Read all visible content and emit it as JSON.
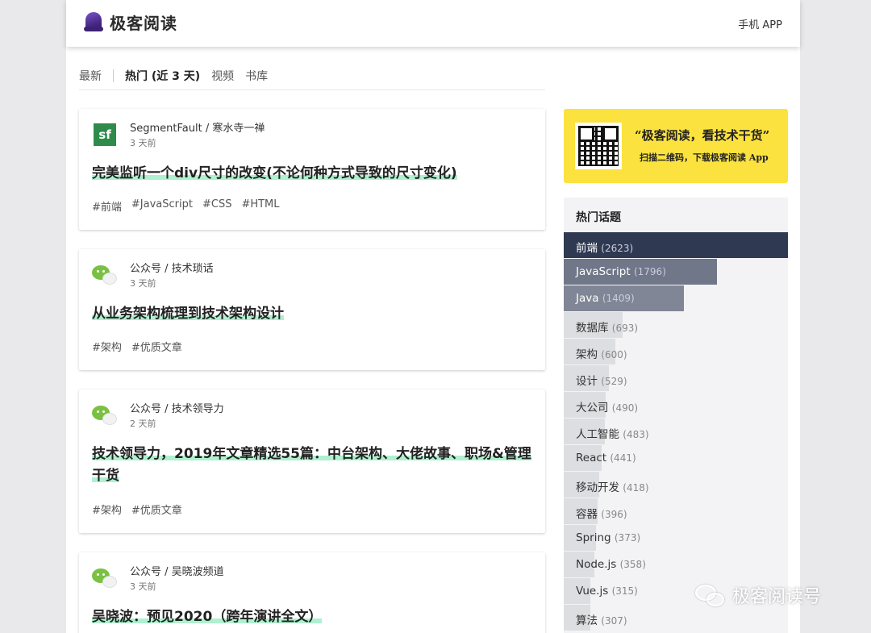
{
  "header": {
    "brand": "极客阅读",
    "mobile_app": "手机 APP"
  },
  "tabs": [
    {
      "label": "最新",
      "active": false
    },
    {
      "label": "热门 (近 3 天)",
      "active": true
    },
    {
      "label": "视频",
      "active": false
    },
    {
      "label": "书库",
      "active": false
    }
  ],
  "articles": [
    {
      "source_icon": "segmentfault-icon",
      "source": "SegmentFault / 寒水寺一禅",
      "time": "3 天前",
      "title": "完美监听一个div尺寸的改变(不论何种方式导致的尺寸变化)",
      "tags": [
        "#前端",
        "#JavaScript",
        "#CSS",
        "#HTML"
      ]
    },
    {
      "source_icon": "wechat-icon",
      "source": "公众号 / 技术琐话",
      "time": "3 天前",
      "title": "从业务架构梳理到技术架构设计",
      "tags": [
        "#架构",
        "#优质文章"
      ]
    },
    {
      "source_icon": "wechat-icon",
      "source": "公众号 / 技术领导力",
      "time": "2 天前",
      "title": "技术领导力，2019年文章精选55篇：中台架构、大佬故事、职场&管理干货",
      "tags": [
        "#架构",
        "#优质文章"
      ]
    },
    {
      "source_icon": "wechat-icon",
      "source": "公众号 / 吴晓波频道",
      "time": "3 天前",
      "title": "吴晓波：预见2020（跨年演讲全文）",
      "tags": []
    }
  ],
  "banner": {
    "title": "“极客阅读，看技术干货”",
    "subtitle": "扫描二维码，下载极客阅读 App"
  },
  "hot_topics": {
    "title": "热门话题",
    "items": [
      {
        "name": "前端",
        "count": "(2623)",
        "value": 2623
      },
      {
        "name": "JavaScript",
        "count": "(1796)",
        "value": 1796
      },
      {
        "name": "Java",
        "count": "(1409)",
        "value": 1409
      },
      {
        "name": "数据库",
        "count": "(693)",
        "value": 693
      },
      {
        "name": "架构",
        "count": "(600)",
        "value": 600
      },
      {
        "name": "设计",
        "count": "(529)",
        "value": 529
      },
      {
        "name": "大公司",
        "count": "(490)",
        "value": 490
      },
      {
        "name": "人工智能",
        "count": "(483)",
        "value": 483
      },
      {
        "name": "React",
        "count": "(441)",
        "value": 441
      },
      {
        "name": "移动开发",
        "count": "(418)",
        "value": 418
      },
      {
        "name": "容器",
        "count": "(396)",
        "value": 396
      },
      {
        "name": "Spring",
        "count": "(373)",
        "value": 373
      },
      {
        "name": "Node.js",
        "count": "(358)",
        "value": 358
      },
      {
        "name": "Vue.js",
        "count": "(315)",
        "value": 315
      },
      {
        "name": "算法",
        "count": "(307)",
        "value": 307
      }
    ]
  },
  "watermark": "极客阅读号",
  "colors": {
    "accent_highlight": "#aef0cf",
    "banner_yellow": "#fbe23e",
    "topic_top": "#2f3a52"
  }
}
